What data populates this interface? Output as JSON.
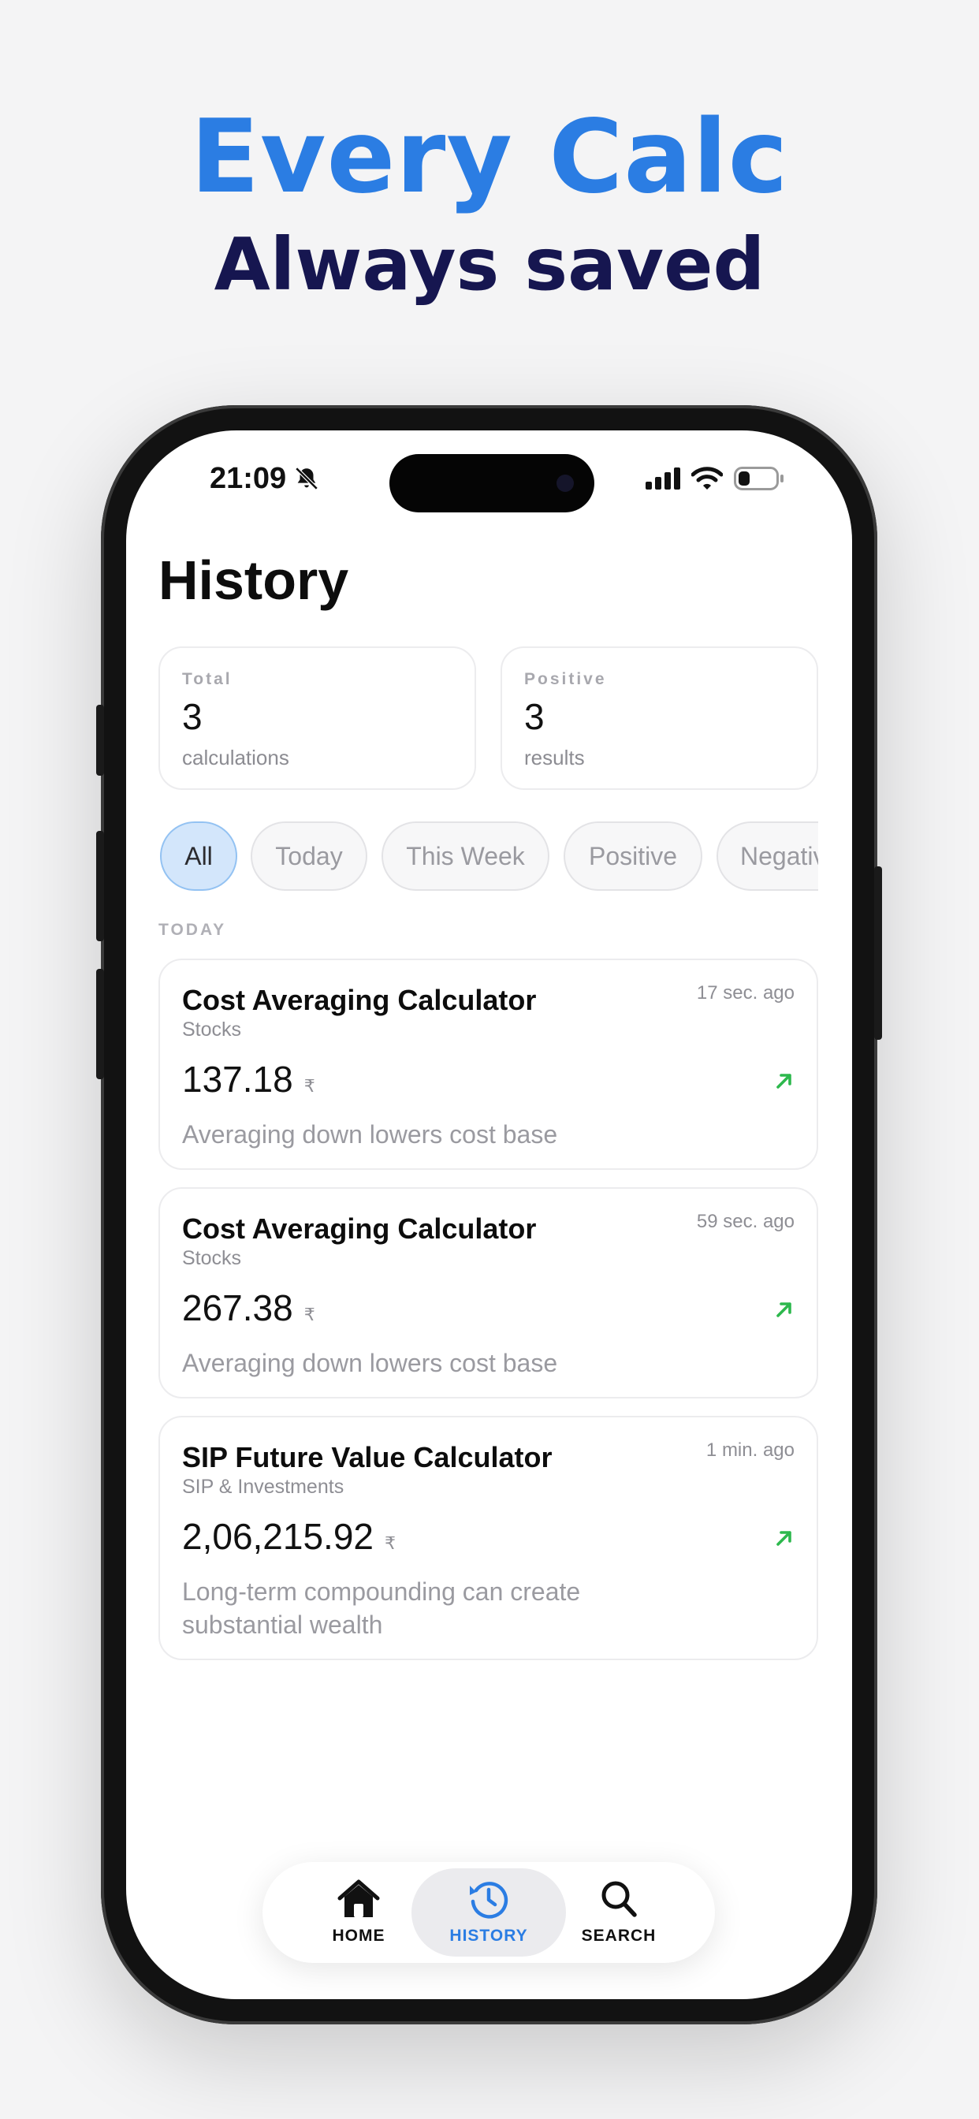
{
  "promo": {
    "headline": "Every Calc",
    "subheadline": "Always saved"
  },
  "status_bar": {
    "time": "21:09",
    "icons": [
      "bell-slash-icon",
      "cellular-signal-icon",
      "wifi-icon",
      "battery-icon"
    ]
  },
  "page": {
    "title": "History"
  },
  "stats": [
    {
      "label": "Total",
      "value": "3",
      "sub": "calculations"
    },
    {
      "label": "Positive",
      "value": "3",
      "sub": "results"
    }
  ],
  "filters": {
    "selected": "All",
    "options": [
      "All",
      "Today",
      "This Week",
      "Positive",
      "Negative"
    ]
  },
  "section": {
    "label": "TODAY"
  },
  "history": [
    {
      "title": "Cost Averaging Calculator",
      "category": "Stocks",
      "time": "17 sec. ago",
      "amount": "137.18",
      "currency": "₹",
      "note": "Averaging down lowers cost base",
      "trend": "up"
    },
    {
      "title": "Cost Averaging Calculator",
      "category": "Stocks",
      "time": "59 sec. ago",
      "amount": "267.38",
      "currency": "₹",
      "note": "Averaging down lowers cost base",
      "trend": "up"
    },
    {
      "title": "SIP Future Value Calculator",
      "category": "SIP & Investments",
      "time": "1 min. ago",
      "amount": "2,06,215.92",
      "currency": "₹",
      "note": "Long-term compounding can create substantial wealth",
      "trend": "up"
    }
  ],
  "tabbar": {
    "active": "HISTORY",
    "tabs": [
      {
        "label": "HOME",
        "icon": "home-icon"
      },
      {
        "label": "HISTORY",
        "icon": "history-icon"
      },
      {
        "label": "SEARCH",
        "icon": "search-icon"
      }
    ]
  },
  "colors": {
    "accent": "#2b7de3",
    "headline_dark": "#161650",
    "positive": "#2db84d",
    "chip_active_bg": "#d3e6fb"
  }
}
